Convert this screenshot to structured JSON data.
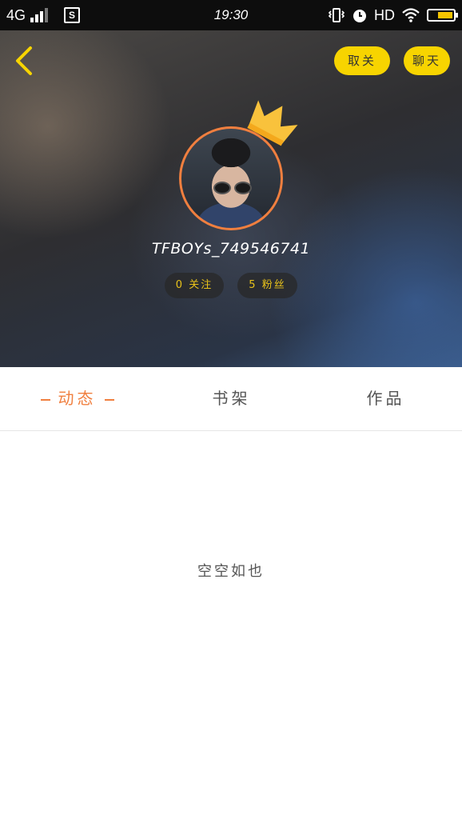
{
  "status_bar": {
    "network": "4G",
    "app_badge": "S",
    "time": "19:30",
    "hd": "HD"
  },
  "header": {
    "follow_label": "取关",
    "chat_label": "聊天",
    "username": "TFBOYs_749546741",
    "following_label": "0 关注",
    "fans_label": "5 粉丝"
  },
  "tabs": [
    {
      "label": "动态",
      "active": true
    },
    {
      "label": "书架",
      "active": false
    },
    {
      "label": "作品",
      "active": false
    }
  ],
  "content": {
    "empty_text": "空空如也"
  },
  "colors": {
    "accent": "#f07f3f",
    "button_yellow": "#f7d400",
    "stat_text": "#e8c21a"
  }
}
